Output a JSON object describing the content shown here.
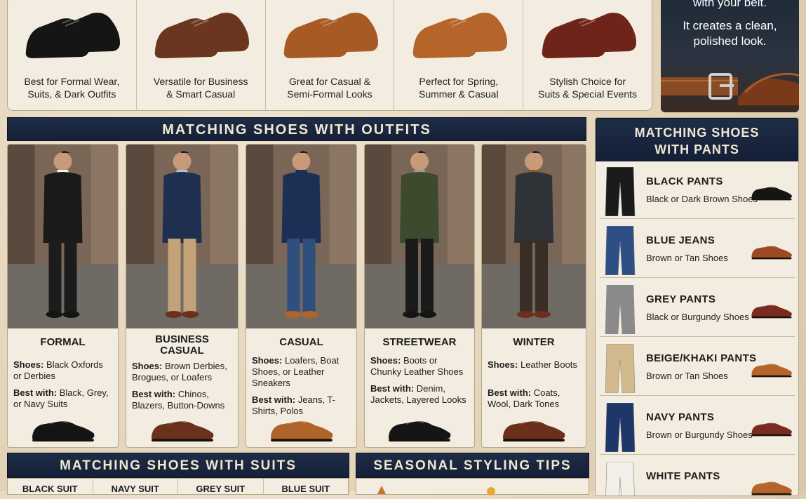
{
  "top_shoes": [
    {
      "desc1": "Best for Formal Wear,",
      "desc2": "Suits, & Dark Outfits",
      "color": "#151515"
    },
    {
      "desc1": "Versatile for Business",
      "desc2": "& Smart Casual",
      "color": "#6b3620"
    },
    {
      "desc1": "Great for Casual &",
      "desc2": "Semi-Formal Looks",
      "color": "#a85a24"
    },
    {
      "desc1": "Perfect for Spring,",
      "desc2": "Summer & Casual",
      "color": "#b5642a"
    },
    {
      "desc1": "Stylish Choice for",
      "desc2": "Suits & Special Events",
      "color": "#6e2418"
    }
  ],
  "belt_card": {
    "line1": "with your belt.",
    "line2": "It creates a clean,",
    "line3": "polished look."
  },
  "outfits": {
    "banner": "MATCHING SHOES WITH OUTFITS",
    "cards": [
      {
        "name": "FORMAL",
        "shoes_label": "Shoes:",
        "shoes": "Black Oxfords or Derbies",
        "best_label": "Best with:",
        "best": "Black, Grey, or Navy Suits",
        "shoe_color": "#141414",
        "jacket": "#1a1a1a",
        "trousers": "#1c1c1c",
        "shirt": "#f2f2f2"
      },
      {
        "name": "BUSINESS CASUAL",
        "shoes_label": "Shoes:",
        "shoes": "Brown Derbies, Brogues, or Loafers",
        "best_label": "Best with:",
        "best": "Chinos, Blazers, Button-Downs",
        "shoe_color": "#6a321c",
        "jacket": "#1f2f4f",
        "trousers": "#c3a27a",
        "shirt": "#a9c4e0"
      },
      {
        "name": "CASUAL",
        "shoes_label": "Shoes:",
        "shoes": "Loafers, Boat Shoes, or Leather Sneakers",
        "best_label": "Best with:",
        "best": "Jeans, T-Shirts, Polos",
        "shoe_color": "#b0642a",
        "jacket": "#1c2f55",
        "trousers": "#2f4f7d",
        "shirt": "#1c2f55"
      },
      {
        "name": "STREETWEAR",
        "shoes_label": "Shoes:",
        "shoes": "Boots or Chunky Leather Shoes",
        "best_label": "Best with:",
        "best": "Denim, Jackets, Layered Looks",
        "shoe_color": "#151515",
        "jacket": "#3d4a2e",
        "trousers": "#1b1b1b",
        "shirt": "#9a9a9a"
      },
      {
        "name": "WINTER",
        "shoes_label": "Shoes:",
        "shoes": "Leather Boots",
        "best_label": "Best with:",
        "best": "Coats, Wool, Dark Tones",
        "shoe_color": "#6b2f1c",
        "jacket": "#2f3338",
        "trousers": "#3a2d25",
        "shirt": "#8a5a30"
      }
    ]
  },
  "pants": {
    "banner_line1": "MATCHING SHOES",
    "banner_line2": "WITH PANTS",
    "rows": [
      {
        "title": "BLACK PANTS",
        "sub": "Black or Dark Brown Shoes",
        "pant_color": "#1a1a1a",
        "shoe_color": "#151515"
      },
      {
        "title": "BLUE JEANS",
        "sub": "Brown or Tan Shoes",
        "pant_color": "#2d4f86",
        "shoe_color": "#9c4a22"
      },
      {
        "title": "GREY PANTS",
        "sub": "Black or Burgundy Shoes",
        "pant_color": "#8a8a8a",
        "shoe_color": "#7a2a1e"
      },
      {
        "title": "BEIGE/KHAKI PANTS",
        "sub": "Brown or Tan Shoes",
        "pant_color": "#d2b98e",
        "shoe_color": "#b5652a"
      },
      {
        "title": "NAVY PANTS",
        "sub": "Brown or Burgundy Shoes",
        "pant_color": "#1f3768",
        "shoe_color": "#7a2a1e"
      },
      {
        "title": "WHITE PANTS",
        "sub": "",
        "pant_color": "#f1efe8",
        "shoe_color": "#b5652a"
      }
    ]
  },
  "suits": {
    "banner": "MATCHING SHOES WITH SUITS",
    "columns": [
      "BLACK SUIT",
      "NAVY SUIT",
      "GREY SUIT",
      "BLUE SUIT"
    ]
  },
  "seasonal": {
    "banner": "SEASONAL STYLING TIPS"
  }
}
